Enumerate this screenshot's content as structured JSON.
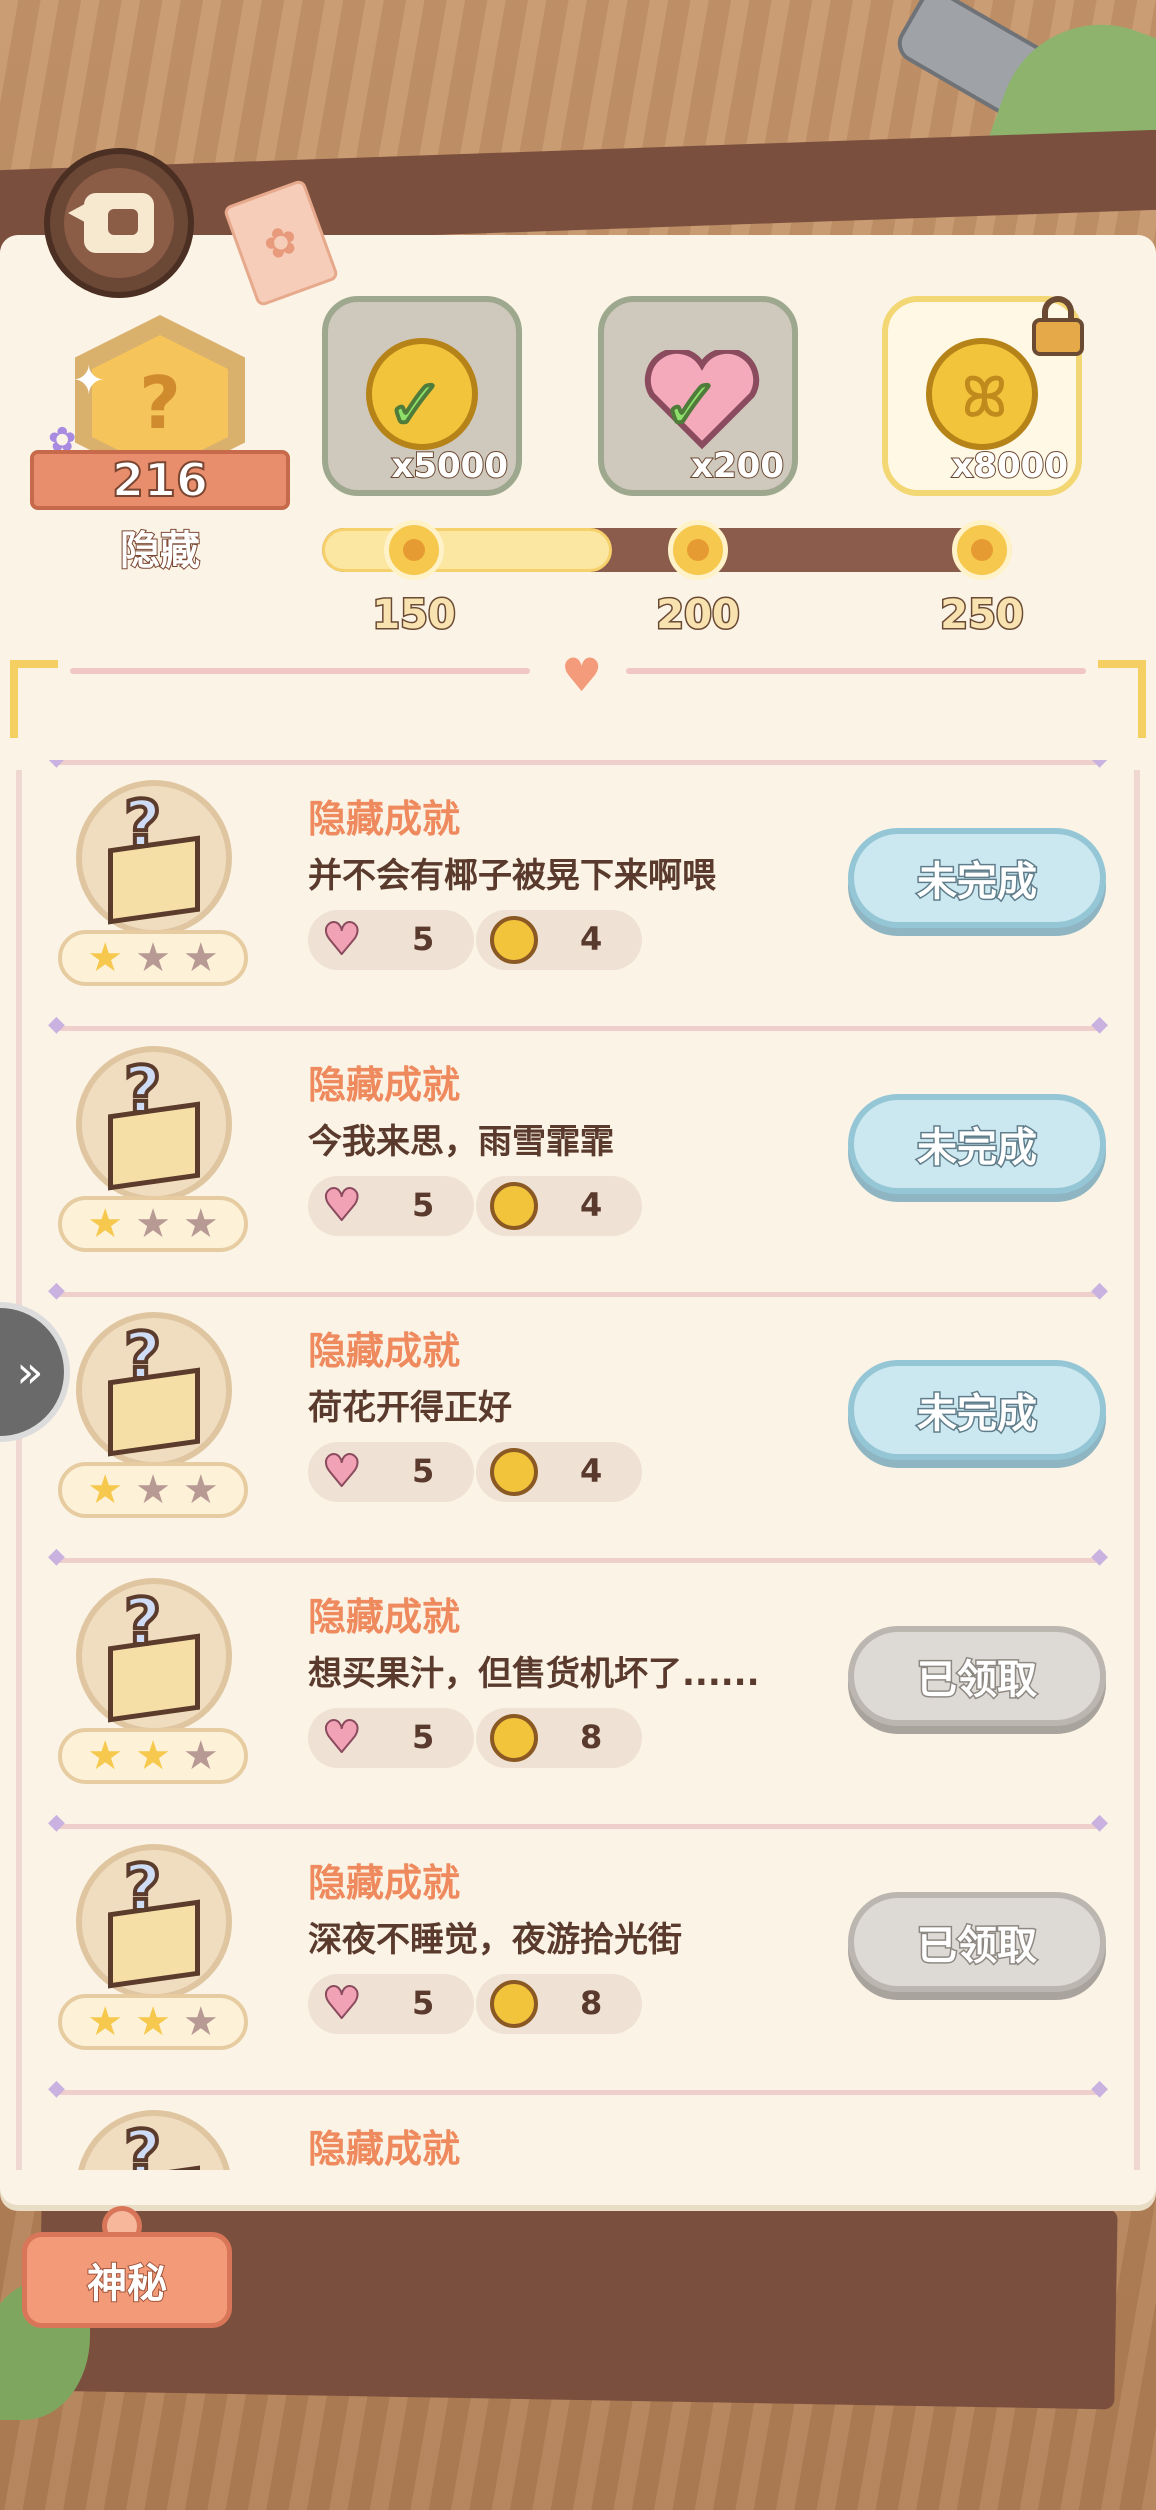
{
  "header": {
    "back_icon": "back-arrow-icon"
  },
  "hidden_badge": {
    "count": "216",
    "label": "隐藏"
  },
  "rewards": [
    {
      "qty": "x5000",
      "icon": "coin-icon",
      "state": "claimed"
    },
    {
      "qty": "x200",
      "icon": "heart-icon",
      "state": "claimed"
    },
    {
      "qty": "x8000",
      "icon": "bunny-coin-icon",
      "state": "locked"
    }
  ],
  "progress": {
    "milestones": [
      "150",
      "200",
      "250"
    ],
    "fill_fraction": 0.42
  },
  "achievements": [
    {
      "title": "隐藏成就",
      "desc": "并不会有椰子被晃下来啊喂",
      "hearts": "5",
      "coins": "4",
      "stars_on": 1,
      "status": "未完成",
      "state": "pending"
    },
    {
      "title": "隐藏成就",
      "desc": "今我来思，雨雪霏霏",
      "hearts": "5",
      "coins": "4",
      "stars_on": 1,
      "status": "未完成",
      "state": "pending"
    },
    {
      "title": "隐藏成就",
      "desc": "荷花开得正好",
      "hearts": "5",
      "coins": "4",
      "stars_on": 1,
      "status": "未完成",
      "state": "pending"
    },
    {
      "title": "隐藏成就",
      "desc": "想买果汁，但售货机坏了......",
      "hearts": "5",
      "coins": "8",
      "stars_on": 2,
      "status": "已领取",
      "state": "done"
    },
    {
      "title": "隐藏成就",
      "desc": "深夜不睡觉，夜游拾光街",
      "hearts": "5",
      "coins": "8",
      "stars_on": 2,
      "status": "已领取",
      "state": "done"
    },
    {
      "title": "隐藏成就"
    }
  ],
  "side_tab": {
    "icon": "double-chevron-right-icon"
  },
  "mystery_button": {
    "label": "神秘"
  }
}
